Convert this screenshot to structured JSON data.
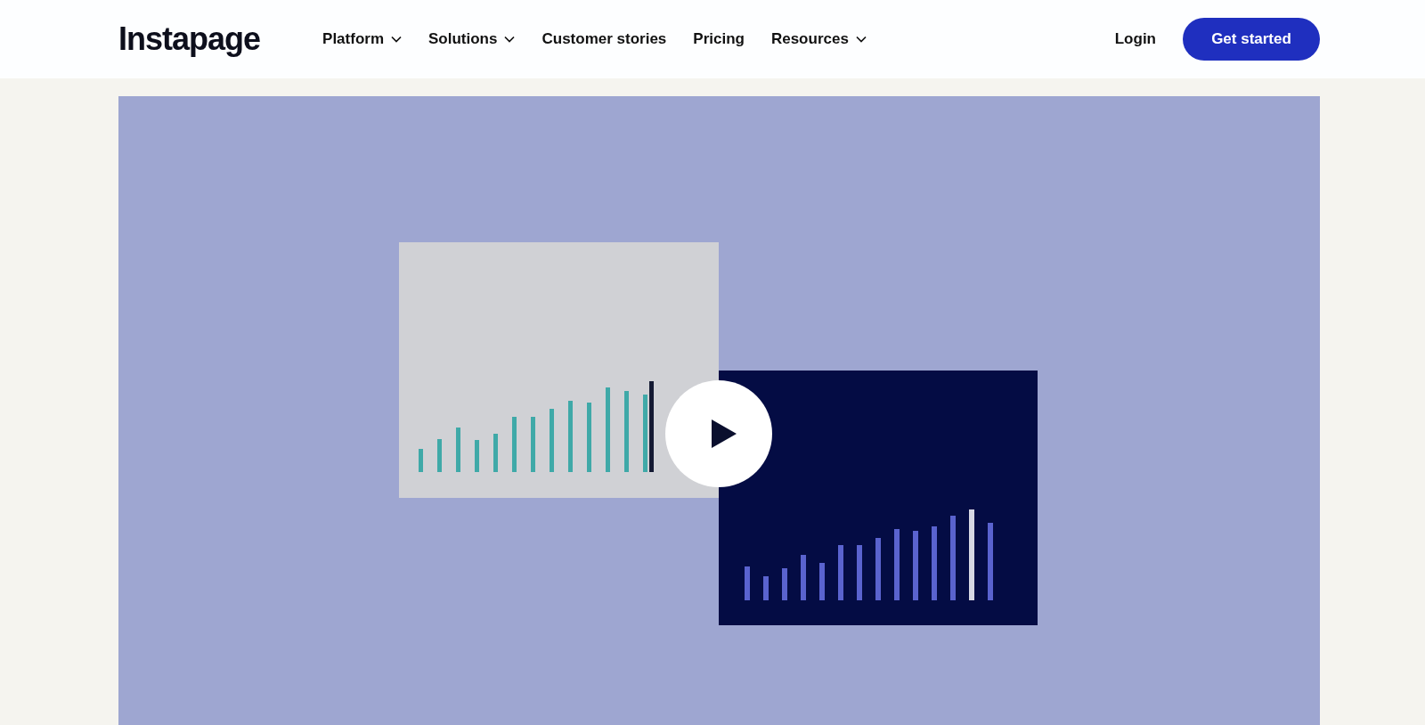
{
  "header": {
    "logo": "Instapage",
    "nav": [
      {
        "label": "Platform",
        "has_dropdown": true
      },
      {
        "label": "Solutions",
        "has_dropdown": true
      },
      {
        "label": "Customer stories",
        "has_dropdown": false
      },
      {
        "label": "Pricing",
        "has_dropdown": false
      },
      {
        "label": "Resources",
        "has_dropdown": true
      }
    ],
    "login": "Login",
    "cta": "Get started"
  }
}
